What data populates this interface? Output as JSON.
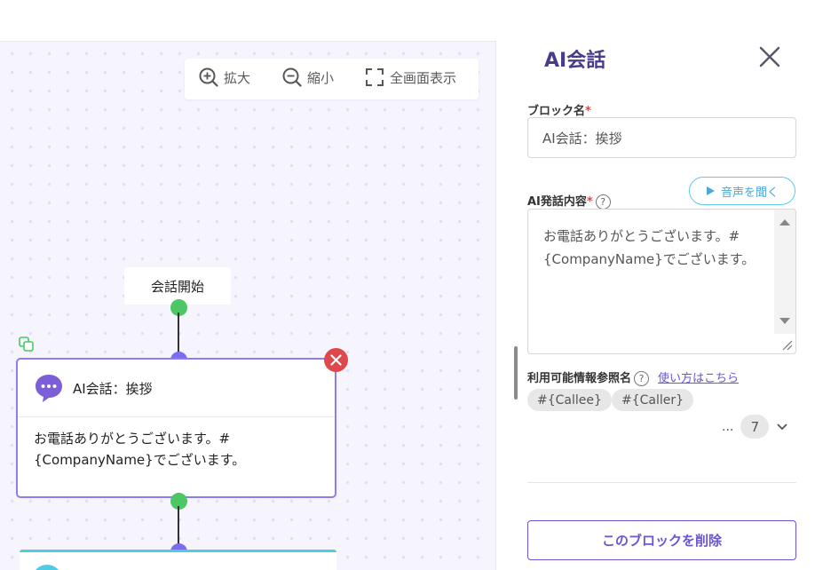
{
  "toolbar": {
    "zoom_in": "拡大",
    "zoom_out": "縮小",
    "fullscreen": "全画面表示"
  },
  "flow": {
    "start_label": "会話開始",
    "node": {
      "title": "AI会話：挨拶",
      "body": "お電話ありがとうございます。#{CompanyName}でございます。"
    }
  },
  "panel": {
    "title": "AI会話",
    "block_name_label": "ブロック名",
    "block_name_value": "AI会話：挨拶",
    "ai_speech_label": "AI発話内容",
    "listen_button": "音声を聞く",
    "ai_speech_text": "お電話ありがとうございます。#{CompanyName}でございます。",
    "available_refs_label": "利用可能情報参照名",
    "usage_link": "使い方はこちら",
    "chips": [
      "#{Callee}",
      "#{Caller}"
    ],
    "more_ellipsis": "...",
    "more_count": "7",
    "delete_button": "このブロックを削除"
  },
  "colors": {
    "accent_purple": "#6b54d6",
    "title_purple": "#4a3a8c",
    "node_border": "#8d7cf3",
    "connector_green": "#4cc764",
    "connector_purple": "#7b6cf0",
    "danger": "#e0474c",
    "listen_cyan": "#5dcbe6"
  },
  "icons": {
    "zoom_in": "zoom-in-icon",
    "zoom_out": "zoom-out-icon",
    "fullscreen": "fullscreen-icon",
    "chat": "chat-bubble-icon",
    "copy": "copy-icon",
    "close": "close-icon",
    "help": "help-icon",
    "play": "play-icon",
    "chevron": "chevron-down-icon"
  }
}
